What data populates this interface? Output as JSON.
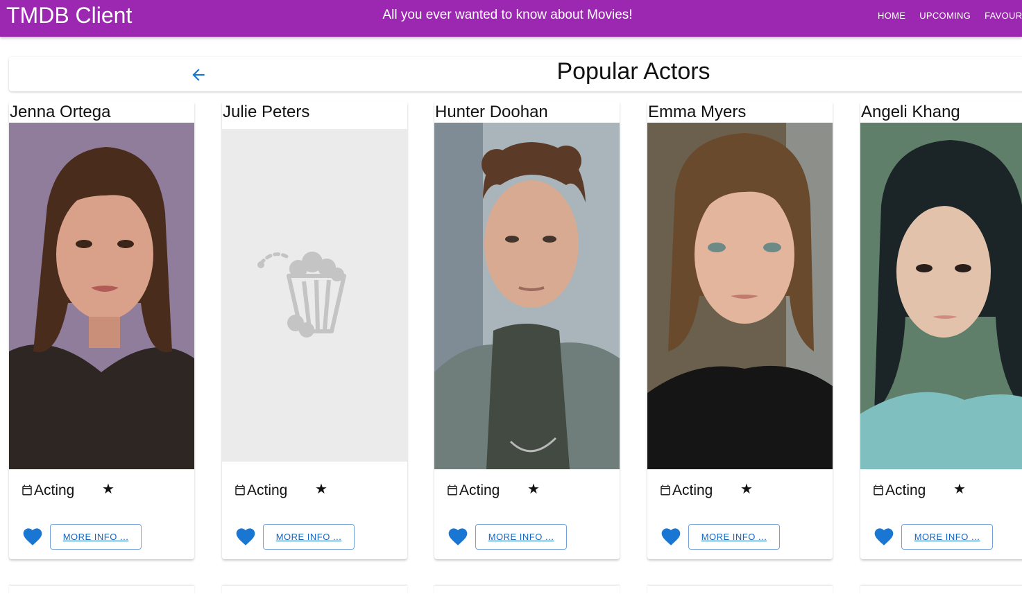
{
  "app": {
    "title": "TMDB Client",
    "tagline": "All you ever wanted to know about Movies!",
    "nav": [
      "HOME",
      "UPCOMING",
      "FAVOURITES"
    ]
  },
  "header": {
    "title": "Popular Actors",
    "back_icon": "arrow-back-icon"
  },
  "actors": [
    {
      "name": "Jenna Ortega",
      "department": "Acting",
      "more_label": "MORE INFO ..."
    },
    {
      "name": "Julie Peters",
      "department": "Acting",
      "more_label": "MORE INFO ..."
    },
    {
      "name": "Hunter Doohan",
      "department": "Acting",
      "more_label": "MORE INFO ..."
    },
    {
      "name": "Emma Myers",
      "department": "Acting",
      "more_label": "MORE INFO ..."
    },
    {
      "name": "Angeli Khang",
      "department": "Acting",
      "more_label": "MORE INFO ..."
    }
  ],
  "icons": {
    "calendar": "calendar-icon",
    "star": "star-icon",
    "favourite": "heart-icon",
    "placeholder": "popcorn-icon"
  },
  "colors": {
    "appbar": "#9c27b0",
    "primary": "#1565c0",
    "heart": "#1976d2",
    "placeholder_bg": "#ebebeb"
  }
}
